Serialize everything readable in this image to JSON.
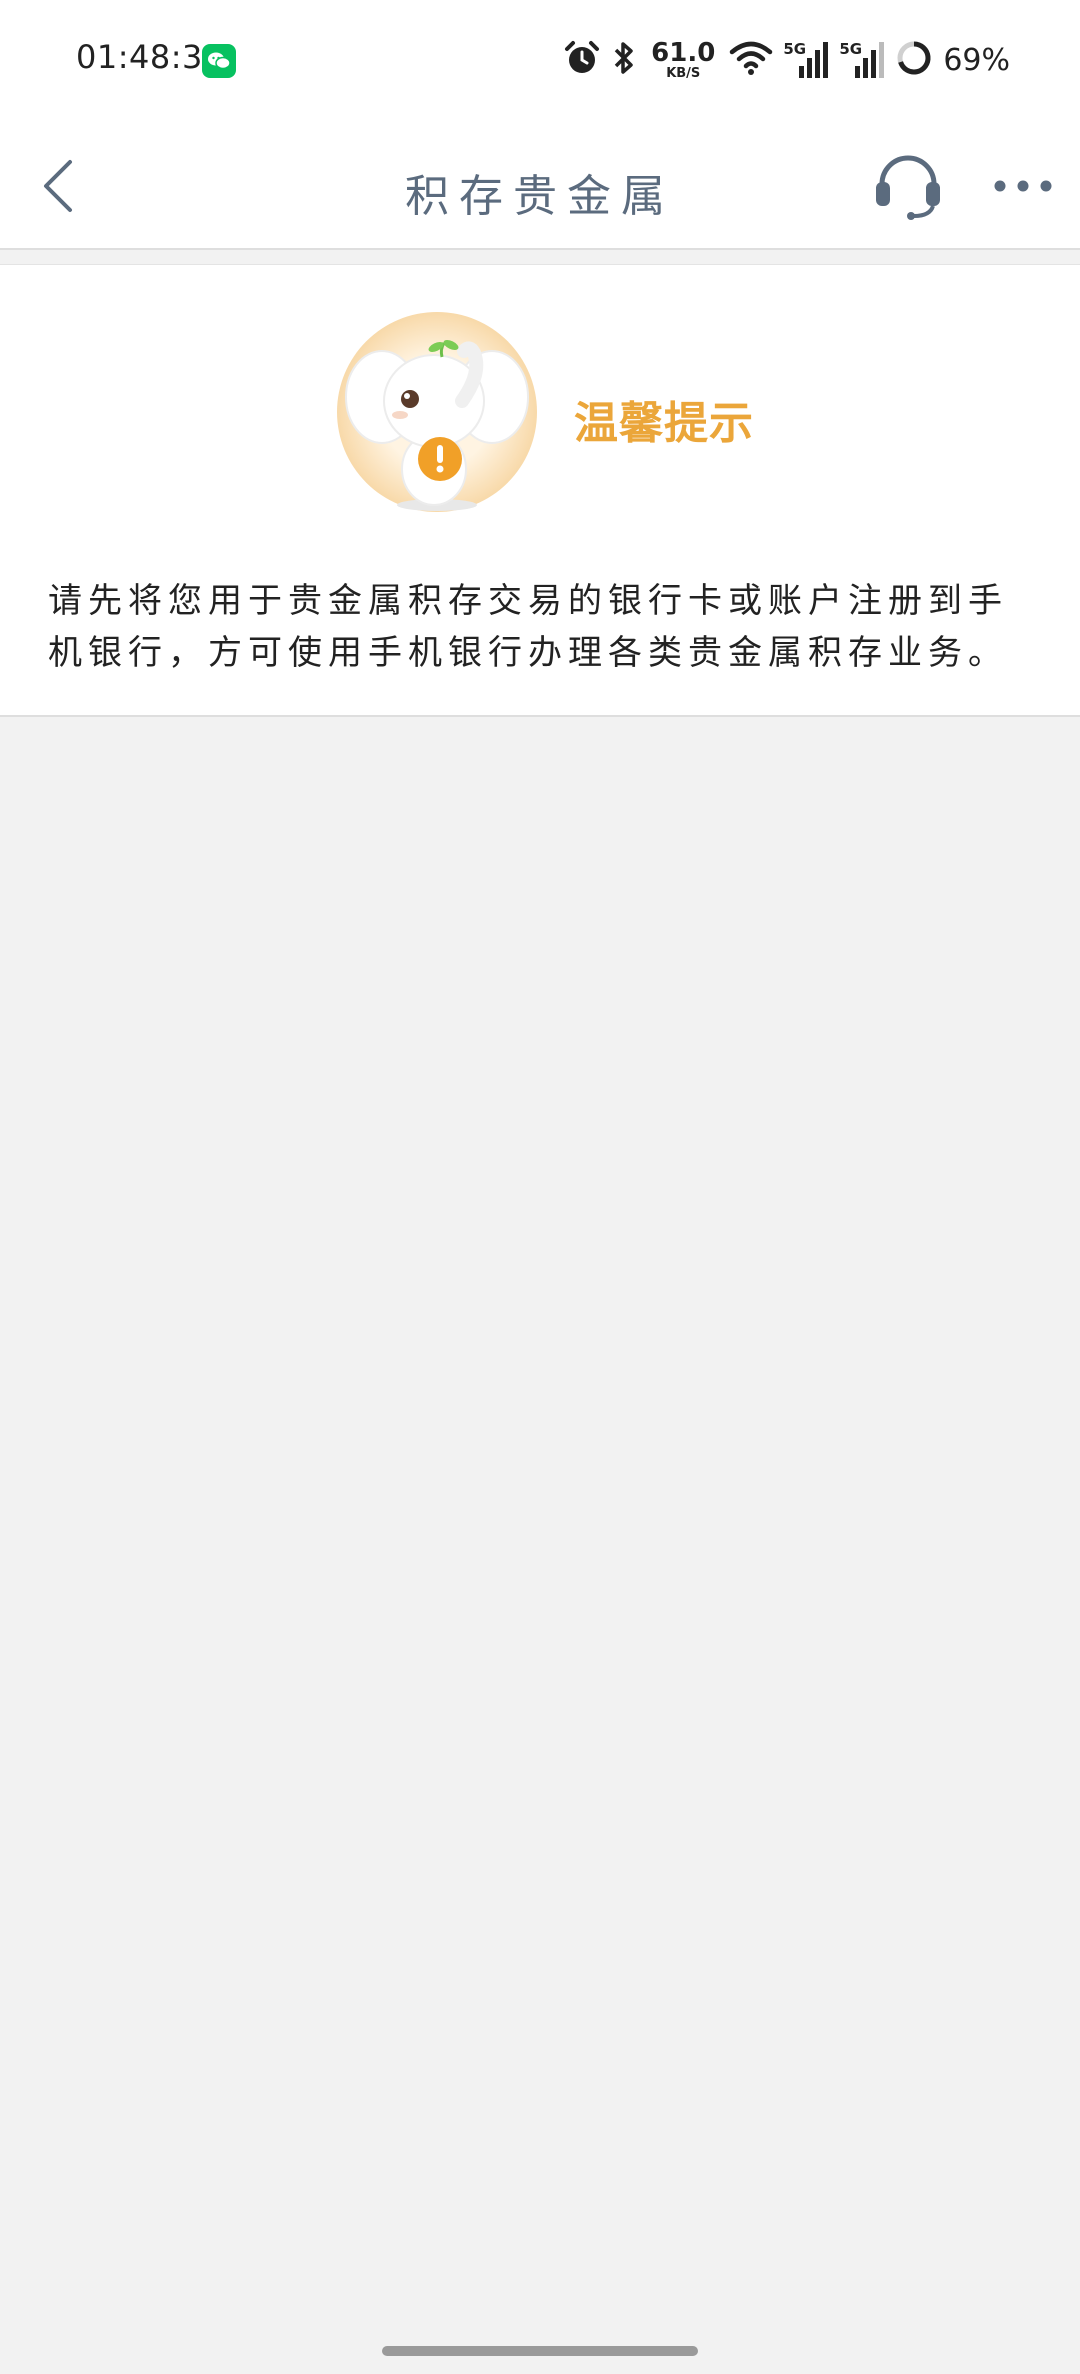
{
  "status_bar": {
    "time": "01:48:33",
    "net_speed_value": "61.0",
    "net_speed_unit": "KB/S",
    "signal1_tag": "5G",
    "signal2_tag": "5G",
    "battery": "69%",
    "icons": [
      "wechat-icon",
      "alarm-icon",
      "bluetooth-icon",
      "wifi-icon",
      "signal-icon",
      "signal-icon",
      "battery-ring-icon"
    ]
  },
  "nav": {
    "title": "积存贵金属",
    "icons": [
      "chevron-left-icon",
      "headset-icon",
      "more-icon"
    ]
  },
  "tip": {
    "title": "温馨提示",
    "message": "请先将您用于贵金属积存交易的银行卡或账户注册到手机银行，方可使用手机银行办理各类贵金属积存业务。",
    "mascot": "elephant-mascot-icon"
  },
  "colors": {
    "accent_orange": "#eba63a",
    "title_slate": "#5b6b7e",
    "background": "#f2f2f2",
    "wechat_green": "#07c160"
  }
}
